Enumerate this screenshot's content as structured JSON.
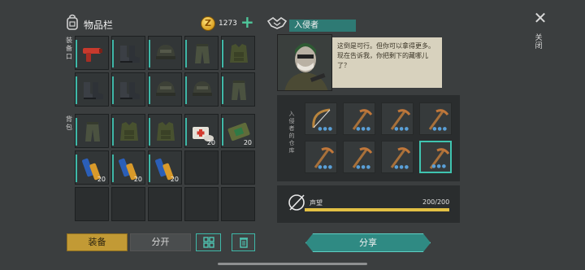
{
  "inventory": {
    "title": "物品栏",
    "coins": "1273",
    "side_labels": {
      "equipment": "装备口",
      "backpack": "背包"
    },
    "equipment_slots": [
      {
        "icon": "flare-gun-icon"
      },
      {
        "icon": "boots-icon"
      },
      {
        "icon": "helmet-icon"
      },
      {
        "icon": "pants-icon"
      },
      {
        "icon": "vest-icon"
      },
      {
        "icon": "boots-icon"
      },
      {
        "icon": "boots-icon"
      },
      {
        "icon": "helmet-icon"
      },
      {
        "icon": "helmet-icon"
      },
      {
        "icon": "pants-icon"
      }
    ],
    "backpack_slots": [
      {
        "icon": "pants-icon",
        "qty": ""
      },
      {
        "icon": "vest-icon",
        "qty": ""
      },
      {
        "icon": "vest-icon",
        "qty": ""
      },
      {
        "icon": "medkit-icon",
        "qty": "20"
      },
      {
        "icon": "bandage-icon",
        "qty": "20"
      },
      {
        "icon": "battery-icon",
        "qty": "20"
      },
      {
        "icon": "battery-icon",
        "qty": "20"
      },
      {
        "icon": "battery-icon",
        "qty": "20"
      },
      {
        "icon": "",
        "qty": ""
      },
      {
        "icon": "",
        "qty": ""
      },
      {
        "icon": "",
        "qty": ""
      },
      {
        "icon": "",
        "qty": ""
      },
      {
        "icon": "",
        "qty": ""
      },
      {
        "icon": "",
        "qty": ""
      },
      {
        "icon": "",
        "qty": ""
      }
    ],
    "buttons": {
      "equip": "装备",
      "split": "分开"
    }
  },
  "npc": {
    "name": "入侵者",
    "dialog": "这倒是可行。但你可以拿得更多。现在告诉我，你把剩下的藏哪儿了？",
    "trade_side_label": "入侵者的仓库",
    "trade_items": [
      "bow-icon",
      "pickaxe-icon",
      "pickaxe-icon",
      "pickaxe-icon",
      "pickaxe-icon",
      "pickaxe-icon",
      "pickaxe-icon",
      "pickaxe-icon"
    ],
    "selected_index": 7
  },
  "reputation": {
    "label": "声望",
    "value": "200/200",
    "fraction": 1.0
  },
  "share_label": "分享",
  "close_label": "关闭",
  "colors": {
    "accent": "#3fb8a8",
    "equip": "#c29a35",
    "rep_bar": "#e2c044"
  }
}
